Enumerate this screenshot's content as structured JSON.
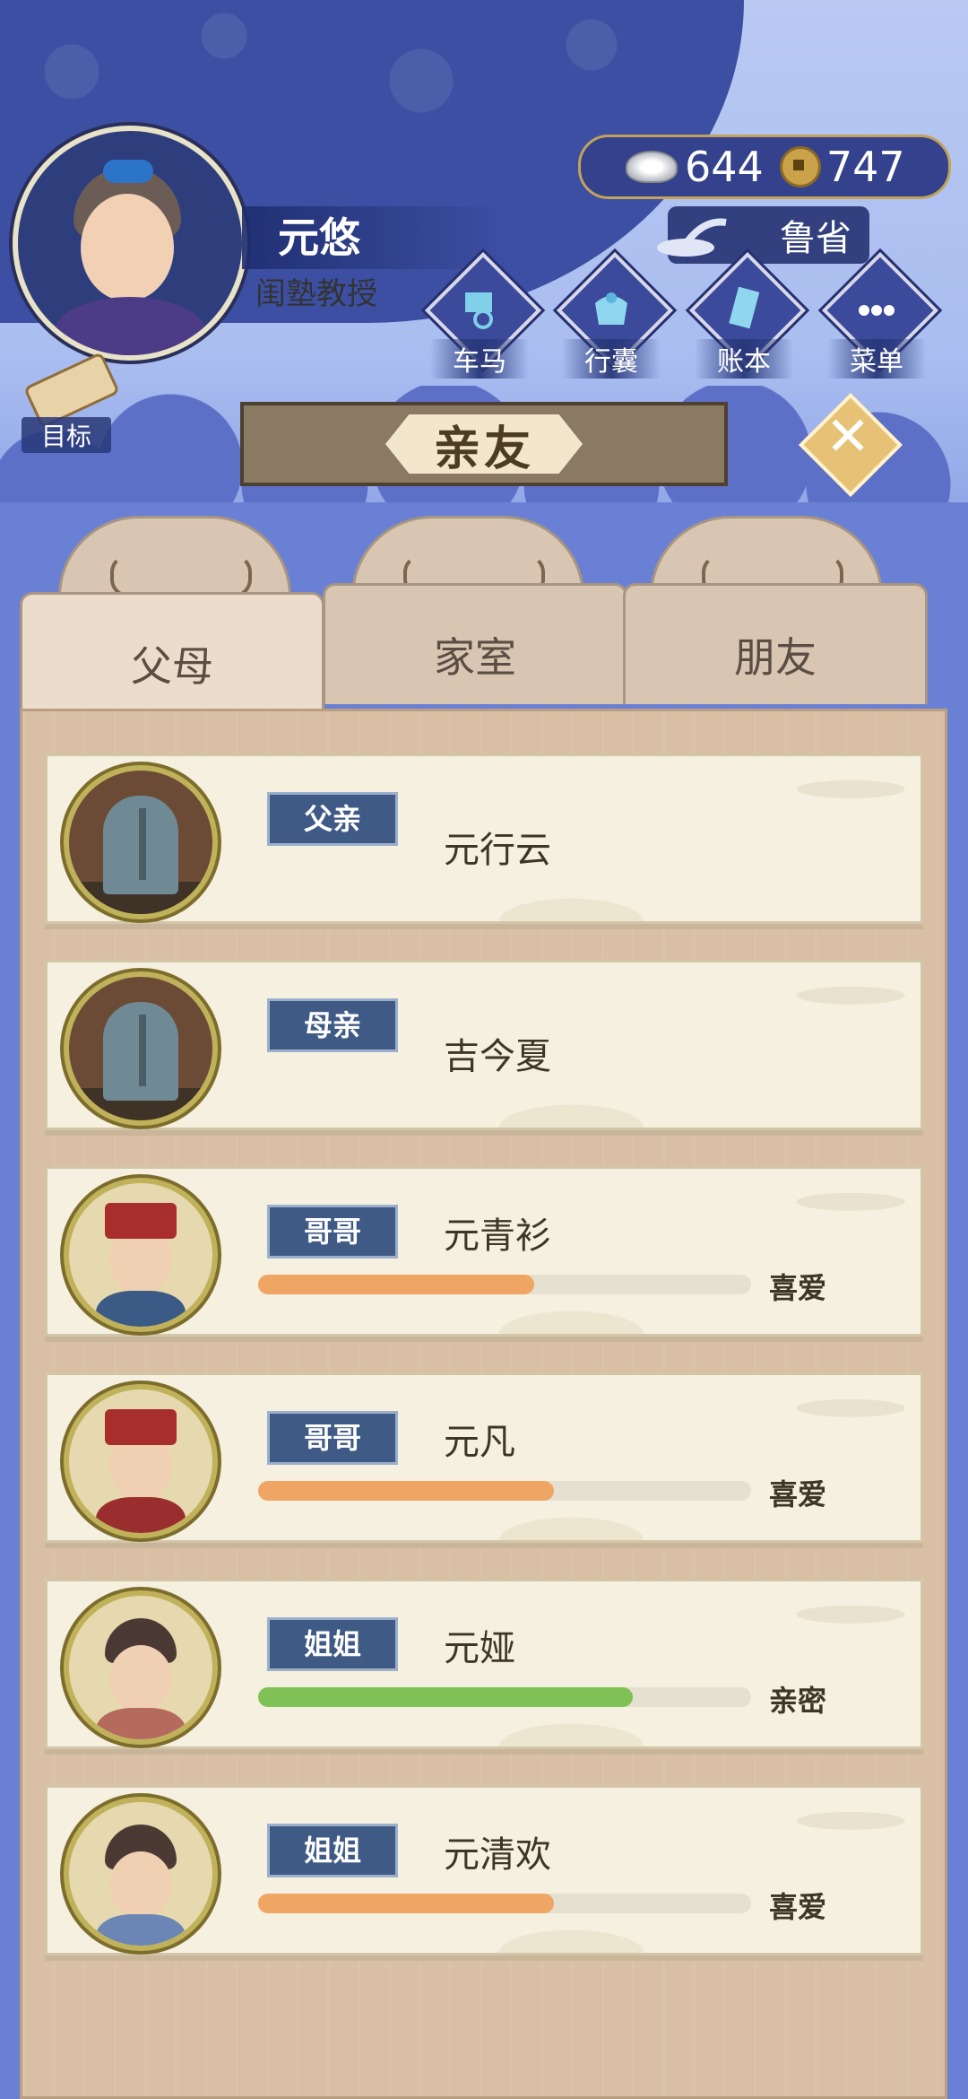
{
  "player": {
    "name": "元悠",
    "title": "闺塾教授"
  },
  "currency": {
    "silver": "644",
    "coins": "747"
  },
  "region": "鲁省",
  "nav_buttons": [
    {
      "label": "车马",
      "icon": "carriage-icon"
    },
    {
      "label": "行囊",
      "icon": "bundle-icon"
    },
    {
      "label": "账本",
      "icon": "ledger-icon"
    },
    {
      "label": "菜单",
      "icon": "menu-dots-icon"
    }
  ],
  "goal_label": "目标",
  "page_title": "亲友",
  "tabs": [
    {
      "label": "父母",
      "active": true
    },
    {
      "label": "家室",
      "active": false
    },
    {
      "label": "朋友",
      "active": false
    }
  ],
  "relatives": [
    {
      "role": "父亲",
      "name": "元行云",
      "deceased": true,
      "portrait": "tombstone-icon"
    },
    {
      "role": "母亲",
      "name": "吉今夏",
      "deceased": true,
      "portrait": "tombstone-icon"
    },
    {
      "role": "哥哥",
      "name": "元青衫",
      "affinity": 0.56,
      "affinity_color": "#efa563",
      "relation": "喜爱",
      "portrait": "man-portrait"
    },
    {
      "role": "哥哥",
      "name": "元凡",
      "affinity": 0.6,
      "affinity_color": "#efa563",
      "relation": "喜爱",
      "portrait": "man-portrait"
    },
    {
      "role": "姐姐",
      "name": "元娅",
      "affinity": 0.76,
      "affinity_color": "#7fc157",
      "relation": "亲密",
      "portrait": "woman-portrait"
    },
    {
      "role": "姐姐",
      "name": "元清欢",
      "affinity": 0.6,
      "affinity_color": "#efa563",
      "relation": "喜爱",
      "portrait": "woman-portrait"
    }
  ]
}
